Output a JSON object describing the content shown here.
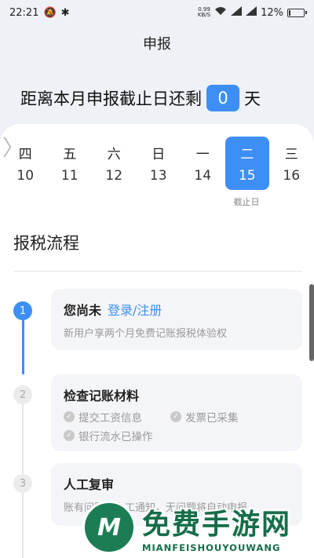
{
  "status_bar": {
    "time": "22:21",
    "net_speed_value": "0.99",
    "net_speed_unit": "KB/S",
    "battery": "12%",
    "battery_level": 0.12
  },
  "header": {
    "title": "申报"
  },
  "deadline": {
    "prefix": "距离本月申报截止日还剩",
    "count": "0",
    "suffix": "天"
  },
  "week": {
    "days": [
      {
        "weekday": "四",
        "date": "10"
      },
      {
        "weekday": "五",
        "date": "11"
      },
      {
        "weekday": "六",
        "date": "12"
      },
      {
        "weekday": "日",
        "date": "13"
      },
      {
        "weekday": "一",
        "date": "14"
      },
      {
        "weekday": "二",
        "date": "15"
      },
      {
        "weekday": "三",
        "date": "16"
      }
    ],
    "selected_index": 5,
    "selected_note": "截止日"
  },
  "process": {
    "title": "报税流程",
    "steps": [
      {
        "number": "1",
        "title": "您尚未",
        "link": "登录/注册",
        "desc": "新用户享两个月免费记账报税体验权"
      },
      {
        "number": "2",
        "title": "检查记账材料",
        "checks": [
          "提交工资信息",
          "发票已采集",
          "银行流水已操作"
        ]
      },
      {
        "number": "3",
        "title": "人工复审",
        "desc": "账有问题将人工通知，无问题将自动申报"
      }
    ]
  },
  "watermark": {
    "logo_letter": "M",
    "title": "免费手游网",
    "subtitle": "MIANFEISHOUYOUWANG"
  },
  "colors": {
    "accent": "#3d8ff5",
    "watermark_green": "#166e49"
  }
}
